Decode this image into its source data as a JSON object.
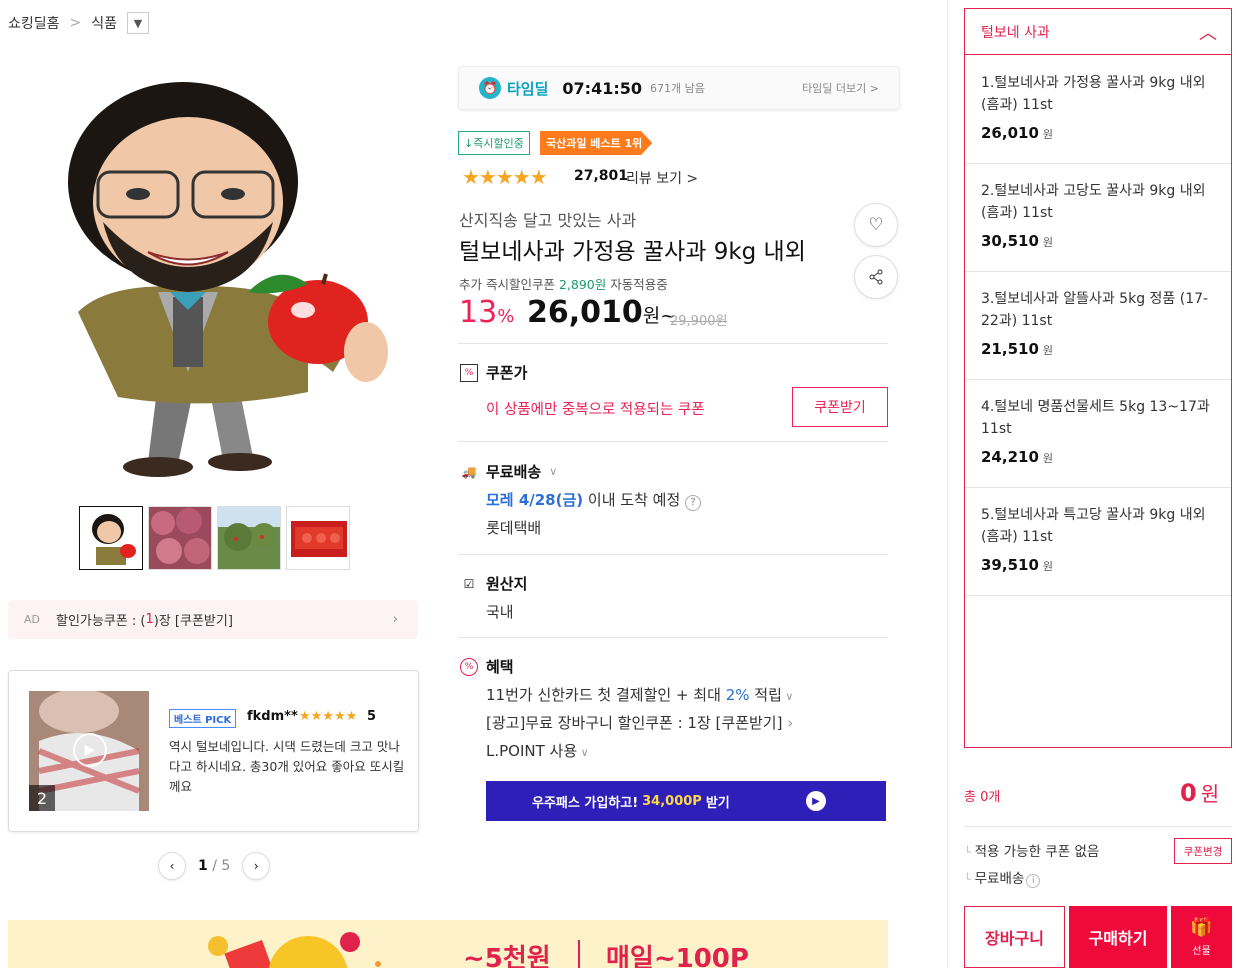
{
  "breadcrumb": {
    "home": "쇼킹딜홈",
    "separator": ">",
    "category": "식품"
  },
  "gallery": {
    "thumb_count": 4
  },
  "ad_coupon": {
    "ad_label": "AD",
    "text_prefix": "할인가능쿠폰 : (",
    "count": "1",
    "text_suffix": ")장 [쿠폰받기]"
  },
  "review": {
    "image_count": "2",
    "badge": "베스트 PICK",
    "user": "fkdm**",
    "stars": "★★★★★",
    "score": "5",
    "text": "역시 털보네입니다. 시댁 드렸는데 크고 맛나다고 하시네요. 총30개 있어요 좋아요 또시킬께요"
  },
  "review_pager": {
    "current": "1",
    "separator": "/",
    "total": "5"
  },
  "banner": {
    "left_text": "~5천원",
    "right_text": "매일~100P"
  },
  "timedeal": {
    "label": "타임딜",
    "time": "07:41:50",
    "remaining": "671개 남음",
    "more": "타임딜 더보기 >"
  },
  "tags": {
    "instant": "↓즉시할인중",
    "best": "국산과일 베스트 1위"
  },
  "rating": {
    "stars": "★★★★★",
    "value": 4.5,
    "count": "27,801",
    "link": "리뷰 보기 >"
  },
  "product": {
    "subtitle": "산지직송 달고 맛있는 사과",
    "title": "털보네사과 가정용 꿀사과 9kg 내외",
    "extra_coupon_prefix": "추가 즉시할인쿠폰",
    "extra_coupon_amount": "2,890원",
    "extra_coupon_suffix": "자동적용중",
    "discount": "13",
    "discount_unit": "%",
    "price": "26,010",
    "price_unit": "원~",
    "original_price": "29,900원"
  },
  "coupon_section": {
    "title": "쿠폰가",
    "desc": "이 상품에만 중복으로 적용되는 쿠폰",
    "button": "쿠폰받기"
  },
  "delivery": {
    "title": "무료배송",
    "date_bold": "모레 4/28(금)",
    "date_rest": "이내 도착 예정",
    "carrier": "롯데택배"
  },
  "origin": {
    "title": "원산지",
    "value": "국내"
  },
  "benefits": {
    "title": "혜택",
    "line1_prefix": "11번가 신한카드 첫 결제할인 + 최대",
    "line1_pct": "2%",
    "line1_suffix": "적립",
    "line2": "[광고]무료 장바구니 할인쿠폰 : 1장 [쿠폰받기]",
    "line3": "L.POINT 사용"
  },
  "upass": {
    "prefix": "우주패스 가입하고!",
    "amount": "34,000P",
    "suffix": "받기"
  },
  "right_panel": {
    "title": "털보네 사과",
    "items": [
      {
        "name": "1.털보네사과 가정용 꿀사과 9kg 내외(흠과) 11st",
        "price": "26,010",
        "unit": "원"
      },
      {
        "name": "2.털보네사과 고당도 꿀사과 9kg 내외(흠과) 11st",
        "price": "30,510",
        "unit": "원"
      },
      {
        "name": "3.털보네사과 알뜰사과 5kg 정품 (17-22과) 11st",
        "price": "21,510",
        "unit": "원"
      },
      {
        "name": "4.털보네 명품선물세트 5kg 13~17과 11st",
        "price": "24,210",
        "unit": "원"
      },
      {
        "name": "5.털보네사과 특고당 꿀사과 9kg 내외(흠과) 11st",
        "price": "39,510",
        "unit": "원"
      }
    ],
    "total_label": "총 0개",
    "total_value": "0",
    "total_unit": "원",
    "note1": "적용 가능한 쿠폰 없음",
    "note2": "무료배송",
    "coupon_change": "쿠폰변경",
    "cart": "장바구니",
    "buy": "구매하기",
    "gift": "선물"
  },
  "colors": {
    "accent": "#e0224d",
    "teal": "#0ba3bd",
    "green": "#1d9a70",
    "orange": "#ff7a1a",
    "star": "#f5a623",
    "upass": "#2d1fb7"
  }
}
